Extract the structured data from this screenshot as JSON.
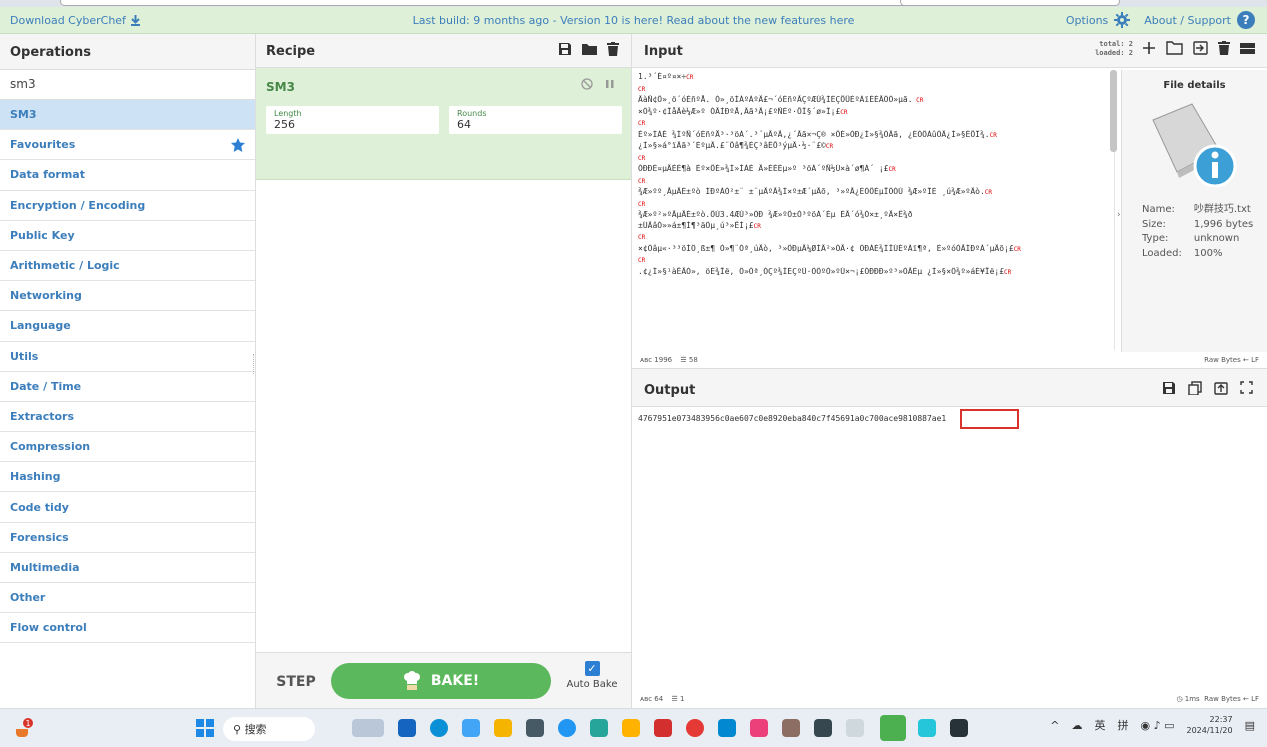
{
  "banner": {
    "download": "Download CyberChef",
    "message": "Last build: 9 months ago - Version 10 is here! Read about the new features here",
    "options": "Options",
    "about": "About / Support"
  },
  "operations": {
    "title": "Operations",
    "search": "sm3",
    "result": "SM3",
    "categories": [
      "Favourites",
      "Data format",
      "Encryption / Encoding",
      "Public Key",
      "Arithmetic / Logic",
      "Networking",
      "Language",
      "Utils",
      "Date / Time",
      "Extractors",
      "Compression",
      "Hashing",
      "Code tidy",
      "Forensics",
      "Multimedia",
      "Other",
      "Flow control"
    ]
  },
  "recipe": {
    "title": "Recipe",
    "op_name": "SM3",
    "length_label": "Length",
    "length_value": "256",
    "rounds_label": "Rounds",
    "rounds_value": "64",
    "step": "STEP",
    "bake": "BAKE!",
    "autobake": "Auto Bake",
    "autobake_checked": true
  },
  "input": {
    "title": "Input",
    "total": "total: 2",
    "loaded": "loaded: 2",
    "lines": [
      "1.³´È¤º¤×÷",
      "",
      "ÃàÑ¢Ô»¸ö´óÉñºÅ. Ò»¸öÍÁºÀºÃ£¬´óÉñºÃÇºÆÚ¾ÍÈÇÕÛÈºÀïÈÈÄÖÒ»µã.",
      "×Ö¾º·¢ÎåÃè¼Æ»º ÓÃÍÐºÅ,Âã³Ä¡£ºÑÈº·ÕÎ§´ø»Î¡£",
      "",
      "Èº»ÍÁÉ ¾ÍºÑ´óÉñºÅ³·³öÀ´.³´µÃºÃ,¿´Ãã×¬Ç® ×ÔÈ»ÓÐ¿Í»§¾ÓÄã, ¿ÉÒÔÀûÓÃ¿Í»§ÈÕÎ¾.",
      "¿Í»§»á°ïÄã³´ÈºµÃ.£¨Õâ¶¾ÈÇ³âÊÕ³ýµÄ·½·¨£©",
      "",
      "ÓÐÐÈ¤µÄÈÈ¶à Èº×ÔÈ»¾Í»ÍÁÈ Ã»ÈÈÈµ»º ³öÀ´ºÑ½Ú×à´ø¶À´ ¡£",
      "",
      "¾Æ»ºº¸ÃµÄÈ±ºò ÍÐºÀÒ²±¨ ±¨µÄºÃ¾Í×º±Æ´µÃõ, ³»ºÃ¿ÉÒÔÈµÏÖÓÚ ¾Æ»ºÎÈ ¸ú¾Æ»ºÃò.",
      "",
      "¾Æ»º²»ºÃµÄÈ±ºò.ÔÚ3.4ÆÚ³»ÓÐ ¾Æ»ºÖ±Ò³ºöÀ´Èµ ÈÃ´ó¾Ò×±¸ºÃ×Ê¾ð",
      "±ÜÃâÒ»»á±¶Ì¶³äÖµ¸ú³»ÊÌ¡£",
      "",
      "×¢Òâµ«·³³öÌÖ¸ß±¶ Ò»¶¨Òª¸úÃò, ³»ÖÐµÄ¼ØÍÄ²»ÓÃ·¢ ÖÐÁÉ¾ÍÎÙÈºÀï¶ª, È»ºóÓÃÍÐºÀ´µÃõ¡£",
      "",
      ".¢¿Í»§¹àÊÄÒ», öÈ¾Îë, Ö»Òª¸ÓÇº¾ÍÈÇºÙ·ÖÖºÒ»ºÙ×¬¡£ÓÐÐÐ»º³»ÓÃÈµ ¿Í»§×Ö¾º»áÈ¥Ïë¡£"
    ],
    "file_details": {
      "title": "File details",
      "name_label": "Name:",
      "name": "吵群技巧.txt",
      "size_label": "Size:",
      "size": "1,996 bytes",
      "type_label": "Type:",
      "type": "unknown",
      "loaded_label": "Loaded:",
      "loaded": "100%"
    },
    "status_chars": "1996",
    "status_lines": "58",
    "status_right": "Raw Bytes  ← LF"
  },
  "output": {
    "title": "Output",
    "hash": "4767951e073483956c0ae607c0e8920eba840c7f45691a0c700ace9810887ae1",
    "status_chars": "64",
    "status_lines": "1",
    "status_time": "1ms",
    "status_right": "Raw Bytes  ← LF"
  },
  "taskbar": {
    "search": "搜索",
    "ime1": "英",
    "ime2": "拼",
    "time": "22:37",
    "date": "2024/11/20"
  }
}
